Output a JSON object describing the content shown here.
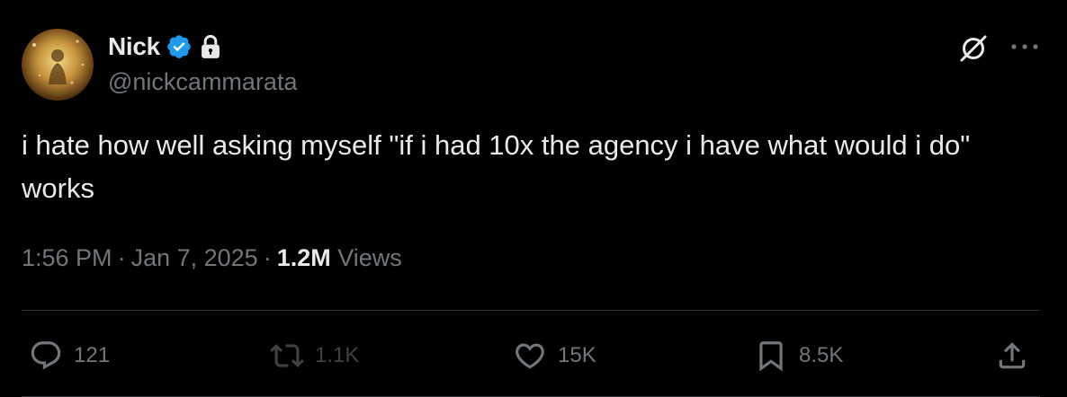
{
  "author": {
    "name": "Nick",
    "handle": "@nickcammarata",
    "verified": true,
    "protected": true,
    "avatar_icon": "avatar-image"
  },
  "header_icons": {
    "grok": "grok-icon",
    "more": "more-icon"
  },
  "tweet": {
    "text": "i hate how well asking myself \"if i had 10x the agency i have what would i do\" works"
  },
  "meta": {
    "time": "1:56 PM",
    "separator": "·",
    "date": "Jan 7, 2025",
    "views_count": "1.2M",
    "views_label": "Views"
  },
  "actions": {
    "reply": {
      "icon": "reply-icon",
      "count": "121"
    },
    "retweet": {
      "icon": "retweet-icon",
      "count": "1.1K"
    },
    "like": {
      "icon": "heart-icon",
      "count": "15K"
    },
    "bookmark": {
      "icon": "bookmark-icon",
      "count": "8.5K"
    },
    "share": {
      "icon": "share-icon"
    }
  },
  "colors": {
    "background": "#000000",
    "primary_text": "#e7e9ea",
    "secondary_text": "#71767b",
    "verified_blue": "#1d9bf0",
    "divider": "#2f3336"
  }
}
